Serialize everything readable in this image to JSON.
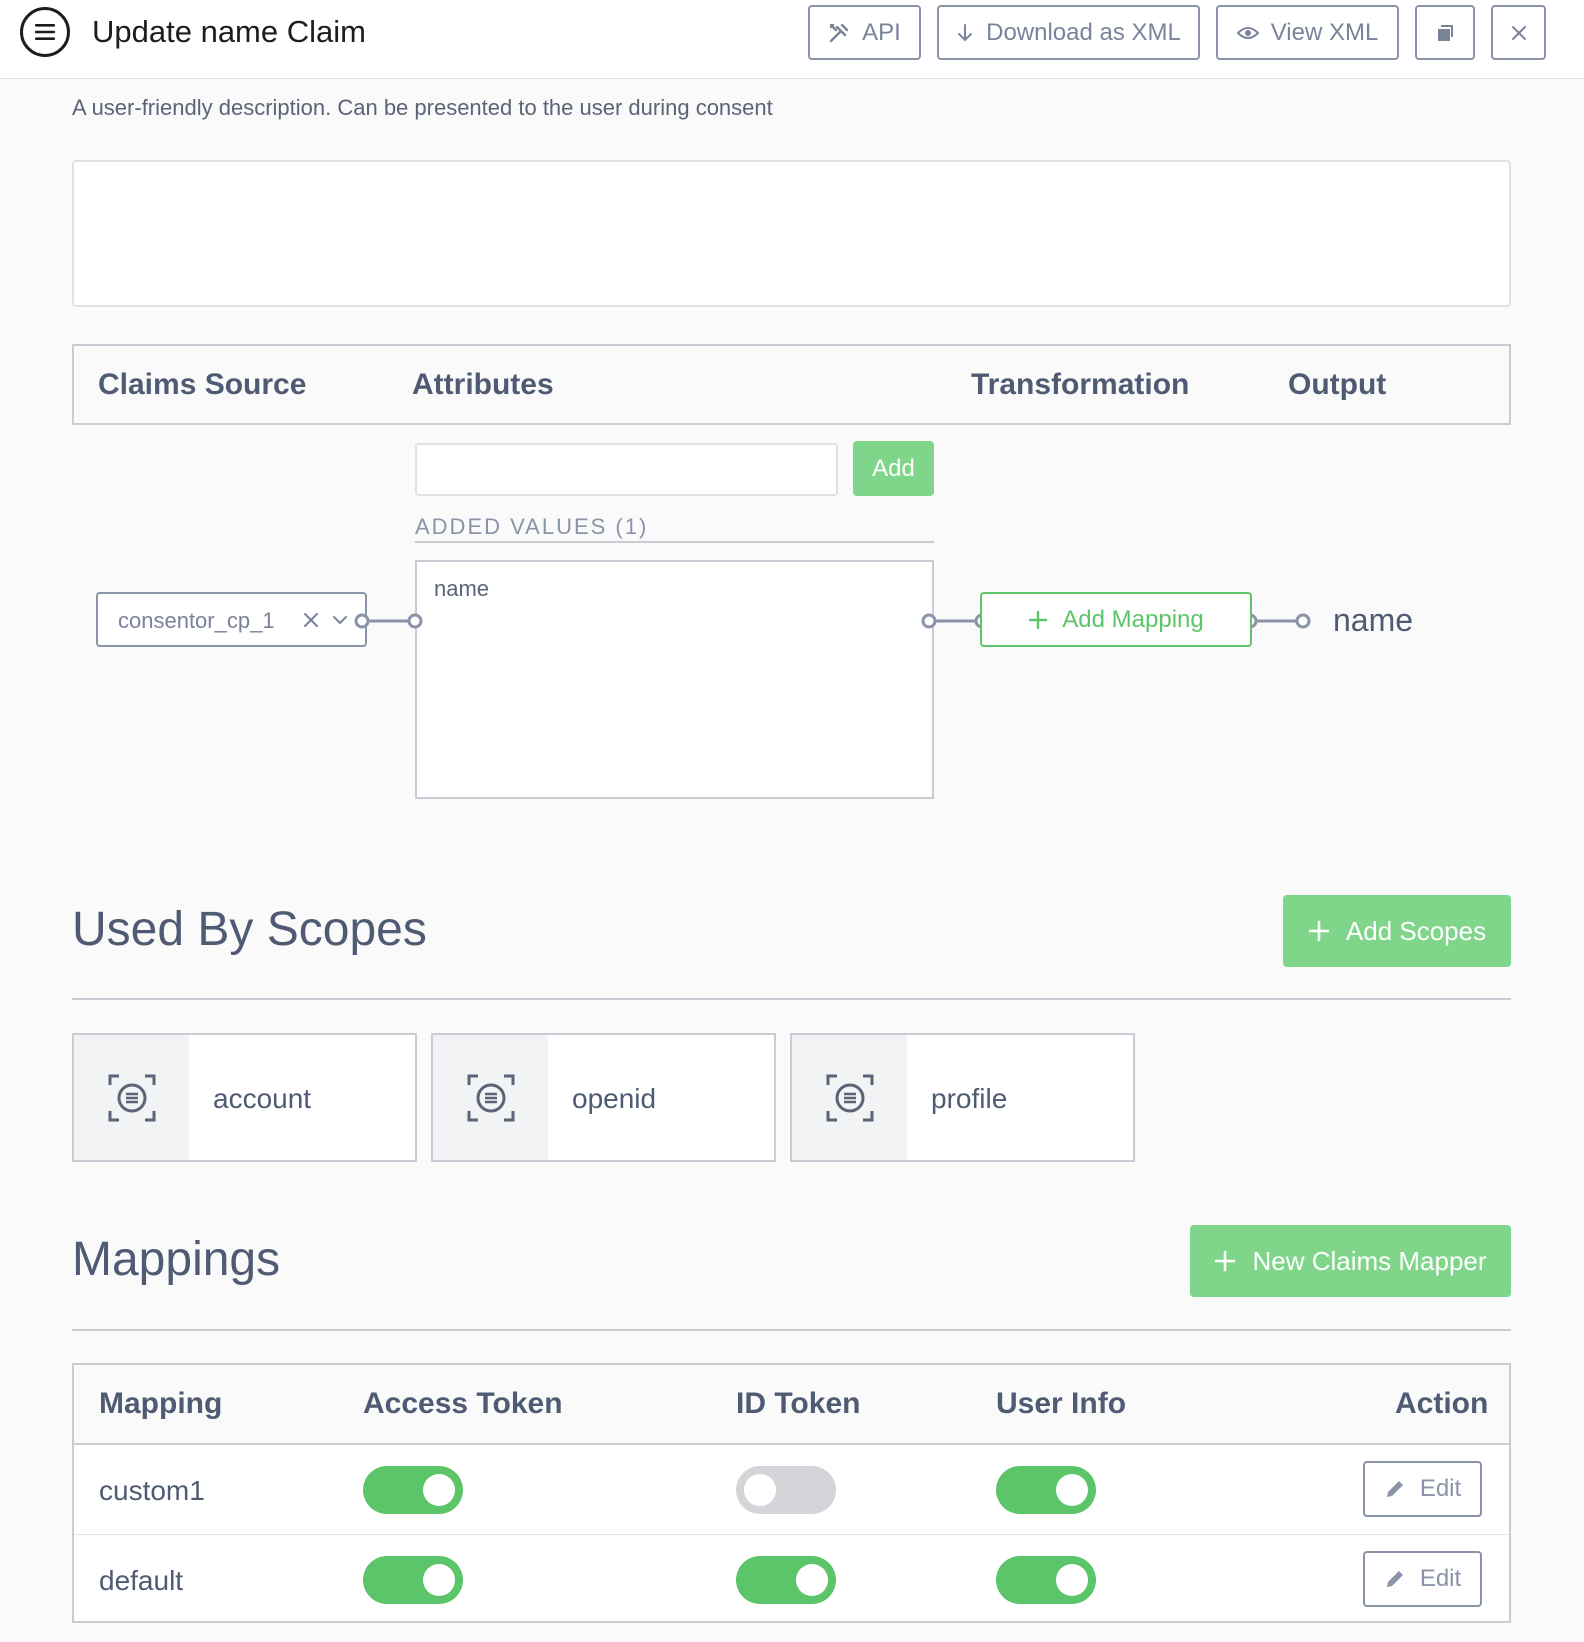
{
  "header": {
    "title": "Update name Claim",
    "buttons": {
      "api": "API",
      "download_xml": "Download as XML",
      "view_xml": "View XML"
    }
  },
  "description": {
    "label": "A user-friendly description. Can be presented to the user during consent",
    "value": ""
  },
  "claims": {
    "columns": [
      "Claims Source",
      "Attributes",
      "Transformation",
      "Output"
    ],
    "source_value": "consentor_cp_1",
    "attribute_input_value": "",
    "add_label": "Add",
    "added_values_label": "ADDED VALUES (1)",
    "added_values": [
      "name"
    ],
    "add_mapping_label": "Add Mapping",
    "output": "name"
  },
  "scopes": {
    "title": "Used By Scopes",
    "add_label": "Add Scopes",
    "items": [
      "account",
      "openid",
      "profile"
    ]
  },
  "mappings": {
    "title": "Mappings",
    "new_label": "New Claims Mapper",
    "columns": [
      "Mapping",
      "Access Token",
      "ID Token",
      "User Info",
      "Action"
    ],
    "rows": [
      {
        "name": "custom1",
        "access_token": true,
        "id_token": false,
        "user_info": true,
        "action": "Edit"
      },
      {
        "name": "default",
        "access_token": true,
        "id_token": true,
        "user_info": true,
        "action": "Edit"
      }
    ]
  },
  "colors": {
    "accent_green": "#5dc569",
    "button_green": "#7fd68a",
    "text_slate": "#4f5a73",
    "border_gray": "#8a93a8"
  }
}
